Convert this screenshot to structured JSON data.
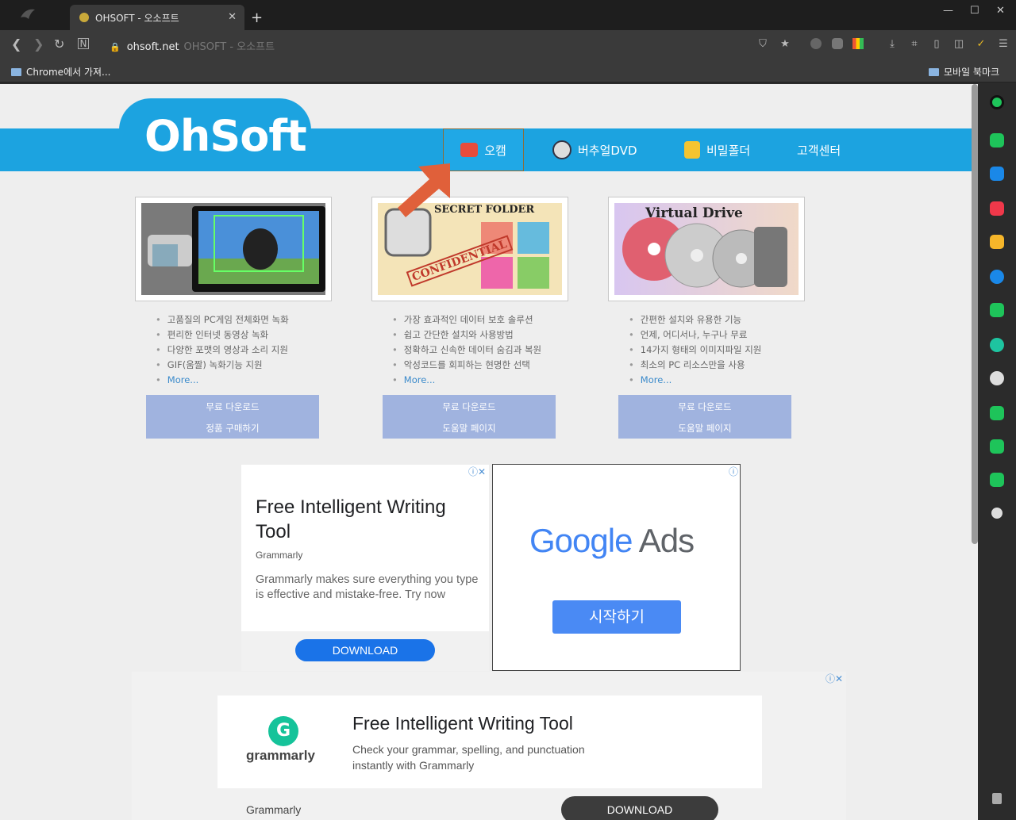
{
  "browser": {
    "tab_title": "OHSOFT - 오소프트",
    "tab_close": "✕",
    "new_tab": "+",
    "url_domain": "ohsoft.net",
    "url_title": "OHSOFT - 오소프트",
    "bookmarks": [
      {
        "label": "Chrome에서 가져..."
      },
      {
        "label": "모바일 북마크"
      }
    ]
  },
  "site": {
    "logo": "OhSoft",
    "nav": [
      {
        "label": "오캠",
        "active": true
      },
      {
        "label": "버추얼DVD",
        "active": false
      },
      {
        "label": "비밀폴더",
        "active": false
      },
      {
        "label": "고객센터",
        "active": false
      }
    ]
  },
  "products": [
    {
      "features": [
        "고품질의 PC게임 전체화면 녹화",
        "편리한 인터넷 동영상 녹화",
        "다양한 포맷의 영상과 소리 지원",
        "GIF(움짤) 녹화기능 지원"
      ],
      "more": "More...",
      "btn1": "무료 다운로드",
      "btn2": "정품 구매하기"
    },
    {
      "img_text": "SECRET FOLDER",
      "stamp": "CONFIDENTIAL",
      "features": [
        "가장 효과적인 데이터 보호 솔루션",
        "쉽고 간단한 설치와 사용방법",
        "정확하고 신속한 데이터 숨김과 복원",
        "악성코드를 회피하는 현명한 선택"
      ],
      "more": "More...",
      "btn1": "무료 다운로드",
      "btn2": "도움말 페이지"
    },
    {
      "img_text": "Virtual Drive",
      "features": [
        "간편한 설치와 유용한 기능",
        "언제, 어디서나, 누구나 무료",
        "14가지 형태의 이미지파일 지원",
        "최소의 PC 리소스만을 사용"
      ],
      "more": "More...",
      "btn1": "무료 다운로드",
      "btn2": "도움말 페이지"
    }
  ],
  "ads": {
    "ad1": {
      "title": "Free Intelligent Writing Tool",
      "brand": "Grammarly",
      "desc": "Grammarly makes sure everything you type is effective and mistake-free. Try now",
      "cta": "DOWNLOAD"
    },
    "ad2": {
      "brand_google": "Google",
      "brand_ads": "Ads",
      "cta": "시작하기"
    },
    "ad3": {
      "logo_text": "grammarly",
      "title": "Free Intelligent Writing Tool",
      "desc": "Check your grammar, spelling, and punctuation instantly with Grammarly",
      "brand": "Grammarly",
      "cta": "DOWNLOAD"
    }
  },
  "colors": {
    "site_blue": "#1ca3e0",
    "arrow": "#e0603a",
    "button_fill": "#a0b3df",
    "ad_cta": "#1a73e8"
  }
}
